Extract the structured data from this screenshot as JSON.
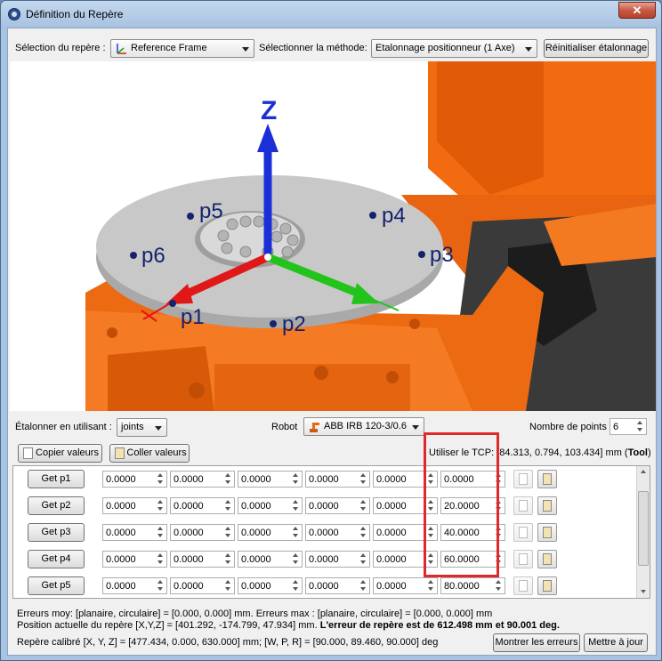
{
  "window": {
    "title": "Définition du Repère",
    "close_glyph": "✕"
  },
  "top": {
    "frame_label": "Sélection du repère :",
    "frame_value": "Reference Frame",
    "method_label": "Sélectionner la méthode:",
    "method_value": "Etalonnage positionneur (1 Axe)",
    "reset_button": "Réinitialiser étalonnage"
  },
  "viewport": {
    "axis_z": "Z",
    "points": [
      "p1",
      "p2",
      "p3",
      "p4",
      "p5",
      "p6"
    ],
    "colors": {
      "robot": "#f26b10",
      "z_axis": "#1a2fd8",
      "x_axis": "#e01818",
      "y_axis": "#22c41c",
      "disc": "#c8c8c8",
      "point": "#14236e"
    }
  },
  "options": {
    "calibrate_label": "Étalonner en utilisant :",
    "calibrate_value": "joints",
    "robot_label": "Robot",
    "robot_value": "ABB IRB 120-3/0.6",
    "num_points_label": "Nombre de points",
    "num_points_value": "6"
  },
  "actions": {
    "copy": "Copier valeurs",
    "paste": "Coller valeurs",
    "tcp_text": "Utiliser le TCP: [84.313, 0.794, 103.434] mm (",
    "tcp_tool": "Tool",
    "tcp_close": ")"
  },
  "table": {
    "rows": [
      {
        "button": "Get p1",
        "values": [
          "0.0000",
          "0.0000",
          "0.0000",
          "0.0000",
          "0.0000",
          "0.0000"
        ]
      },
      {
        "button": "Get p2",
        "values": [
          "0.0000",
          "0.0000",
          "0.0000",
          "0.0000",
          "0.0000",
          "20.0000"
        ]
      },
      {
        "button": "Get p3",
        "values": [
          "0.0000",
          "0.0000",
          "0.0000",
          "0.0000",
          "0.0000",
          "40.0000"
        ]
      },
      {
        "button": "Get p4",
        "values": [
          "0.0000",
          "0.0000",
          "0.0000",
          "0.0000",
          "0.0000",
          "60.0000"
        ]
      },
      {
        "button": "Get p5",
        "values": [
          "0.0000",
          "0.0000",
          "0.0000",
          "0.0000",
          "0.0000",
          "80.0000"
        ]
      }
    ]
  },
  "status": {
    "line1": "Erreurs moy: [planaire, circulaire] = [0.000, 0.000] mm. Erreurs max : [planaire, circulaire] = [0.000, 0.000] mm",
    "line2_normal": "Position actuelle du repère [X,Y,Z] = [401.292, -174.799, 47.934] mm. ",
    "line2_bold": "L'erreur de repère est de 612.498 mm et 90.001 deg.",
    "line3": "Repère calibré [X, Y, Z] = [477.434, 0.000, 630.000] mm; [W, P, R] = [90.000, 89.460, 90.000] deg",
    "show_errors": "Montrer les erreurs",
    "update": "Mettre à jour"
  }
}
